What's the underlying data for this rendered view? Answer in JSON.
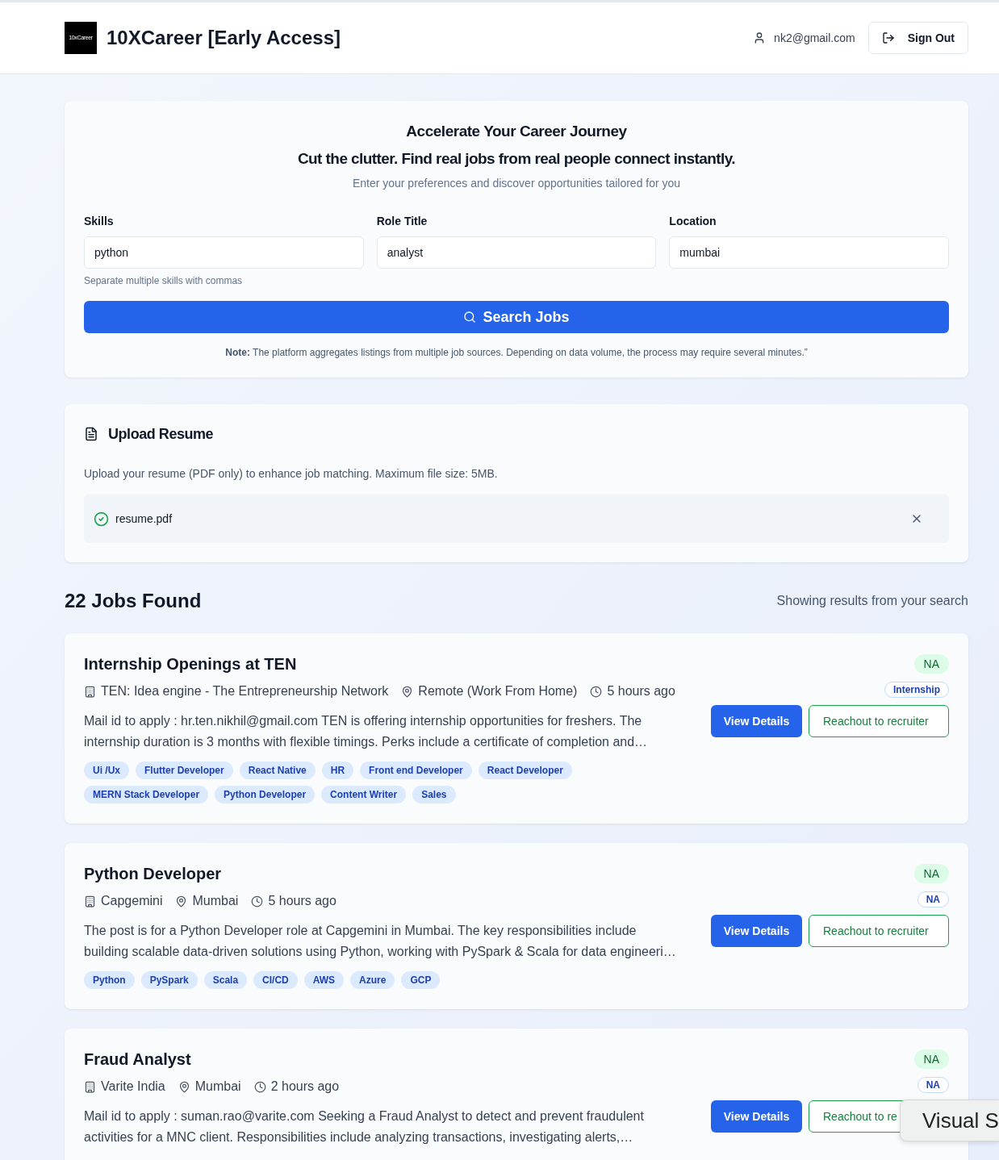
{
  "header": {
    "logo_text": "10xCareer",
    "title": "10XCareer [Early Access]",
    "user_email": "nk2@gmail.com",
    "sign_out": "Sign Out"
  },
  "search_panel": {
    "heading": "Accelerate Your Career Journey",
    "tagline": "Cut the clutter. Find real jobs from real people connect instantly.",
    "subtitle": "Enter your preferences and discover opportunities tailored for you",
    "fields": [
      {
        "label": "Skills",
        "value": "python",
        "hint": "Separate multiple skills with commas"
      },
      {
        "label": "Role Title",
        "value": "analyst"
      },
      {
        "label": "Location",
        "value": "mumbai"
      }
    ],
    "search_button": "Search Jobs",
    "note": "**Note:** The platform aggregates listings from multiple job sources. Depending on data volume, the process may require several minutes.”"
  },
  "resume_panel": {
    "title": "Upload Resume",
    "description": "Upload your resume (PDF only) to enhance job matching. Maximum file size: 5MB.",
    "file_name": "resume.pdf"
  },
  "results": {
    "count_heading": "22 Jobs Found",
    "summary": "Showing results from your search"
  },
  "jobs": [
    {
      "title": "Internship Openings at TEN",
      "company": "TEN: Idea engine - The Entrepreneurship Network",
      "location": "Remote (Work From Home)",
      "posted": "5 hours ago",
      "description": [
        "Mail id to apply : hr.ten.nikhil@gmail.com TEN is offering internship opportunities for freshers. The",
        "internship duration is 3 months with flexible timings. Perks include a certificate of completion and…"
      ],
      "score_badge": "NA",
      "type_badge": "Internship",
      "view_button": "View Details",
      "reachout_button": "Reachout to recruiter",
      "tags": [
        "Ui /Ux",
        "Flutter Developer",
        "React Native",
        "HR",
        "Front end Developer",
        "React Developer",
        "MERN Stack Developer",
        "Python Developer",
        "Content Writer",
        "Sales"
      ]
    },
    {
      "title": "Python Developer",
      "company": "Capgemini",
      "location": "Mumbai",
      "posted": "5 hours ago",
      "description": [
        "The post is for a Python Developer role at Capgemini in Mumbai. The key responsibilities include",
        "building scalable data-driven solutions using Python, working with PySpark & Scala for data engineeri…"
      ],
      "score_badge": "NA",
      "type_badge": "NA",
      "view_button": "View Details",
      "reachout_button": "Reachout to recruiter",
      "tags": [
        "Python",
        "PySpark",
        "Scala",
        "CI/CD",
        "AWS",
        "Azure",
        "GCP"
      ]
    },
    {
      "title": "Fraud Analyst",
      "company": "Varite India",
      "location": "Mumbai",
      "posted": "2 hours ago",
      "description": [
        "Mail id to apply : suman.rao@varite.com Seeking a Fraud Analyst to detect and prevent fraudulent",
        "activities for a MNC client. Responsibilities include analyzing transactions, investigating alerts,…"
      ],
      "score_badge": "NA",
      "type_badge": "NA",
      "view_button": "View Details",
      "reachout_button": "Reachout to re"
    }
  ],
  "floating_tooltip": {
    "text": "Visual S"
  }
}
